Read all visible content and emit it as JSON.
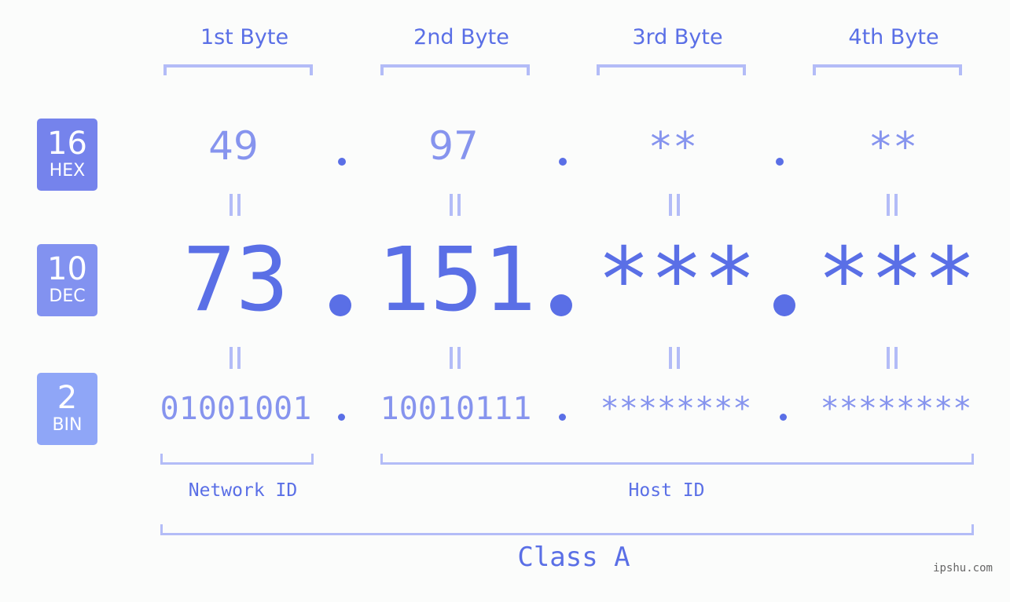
{
  "ip_display": {
    "bytes": [
      {
        "label": "1st Byte",
        "hex": "49",
        "dec": "73",
        "bin": "01001001"
      },
      {
        "label": "2nd Byte",
        "hex": "97",
        "dec": "151",
        "bin": "10010111"
      },
      {
        "label": "3rd Byte",
        "hex": "**",
        "dec": "***",
        "bin": "********"
      },
      {
        "label": "4th Byte",
        "hex": "**",
        "dec": "***",
        "bin": "********"
      }
    ],
    "bases": [
      {
        "number": "16",
        "name": "HEX",
        "color": "#7583ec"
      },
      {
        "number": "10",
        "name": "DEC",
        "color": "#8292f0"
      },
      {
        "number": "2",
        "name": "BIN",
        "color": "#8fa6f7"
      }
    ],
    "separator": ".",
    "network_id_label": "Network ID",
    "host_id_label": "Host ID",
    "class_label": "Class A"
  },
  "colors": {
    "primary": "#5a6fe6",
    "secondary": "#8694ee",
    "bracket": "#b3bcf7"
  },
  "watermark": "ipshu.com"
}
